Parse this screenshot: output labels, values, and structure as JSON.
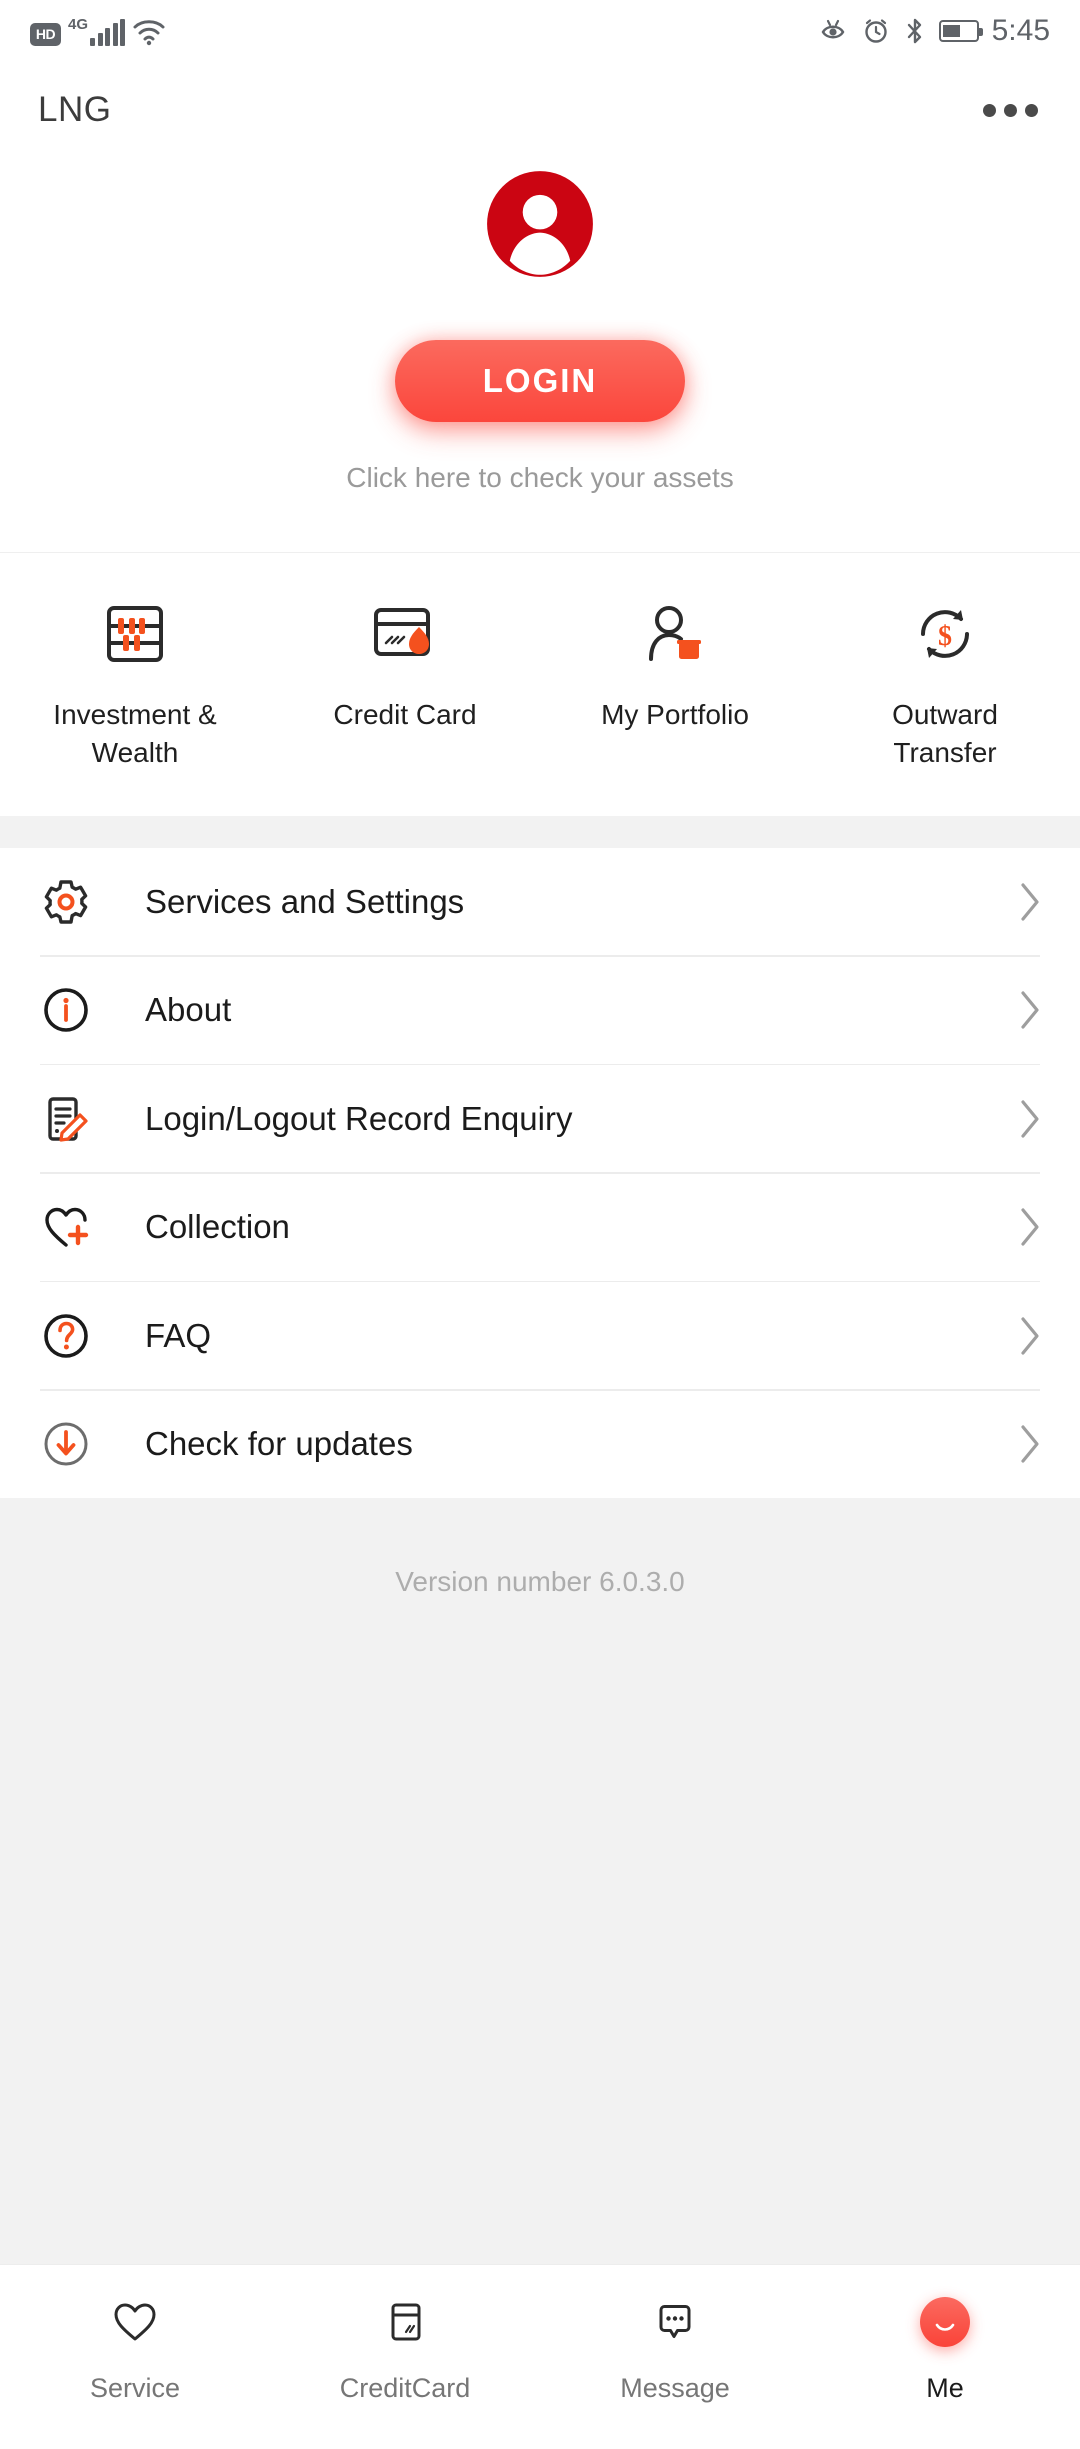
{
  "status_bar": {
    "hd_badge": "HD",
    "network_type": "4G",
    "time": "5:45",
    "icons": [
      "hd-icon",
      "signal-icon",
      "wifi-icon",
      "eye-comfort-icon",
      "alarm-icon",
      "bluetooth-icon",
      "battery-icon"
    ]
  },
  "app_bar": {
    "title": "LNG",
    "overflow_menu": "more-options"
  },
  "profile": {
    "avatar_alt": "user-avatar",
    "avatar_color": "#CB0512",
    "login_label": "LOGIN",
    "login_hint": "Click here to check your assets",
    "login_gradient_from": "#FB6A5E",
    "login_gradient_to": "#FB463C"
  },
  "quick_actions": [
    {
      "label": "Investment & Wealth",
      "icon": "abacus-icon"
    },
    {
      "label": "Credit Card",
      "icon": "credit-card-flame-icon"
    },
    {
      "label": "My Portfolio",
      "icon": "person-briefcase-icon"
    },
    {
      "label": "Outward Transfer",
      "icon": "transfer-dollar-icon"
    }
  ],
  "menu": [
    {
      "label": "Services and Settings",
      "icon": "gear-icon"
    },
    {
      "label": "About",
      "icon": "info-circle-icon"
    },
    {
      "label": "Login/Logout Record Enquiry",
      "icon": "document-pencil-icon"
    },
    {
      "label": "Collection",
      "icon": "heart-plus-icon"
    },
    {
      "label": "FAQ",
      "icon": "question-circle-icon"
    },
    {
      "label": "Check for updates",
      "icon": "download-circle-icon"
    }
  ],
  "footer": {
    "version_text": "Version number 6.0.3.0"
  },
  "tab_bar": {
    "active_index": 3,
    "items": [
      {
        "label": "Service",
        "icon": "heart-icon"
      },
      {
        "label": "CreditCard",
        "icon": "card-icon"
      },
      {
        "label": "Message",
        "icon": "chat-bubble-icon"
      },
      {
        "label": "Me",
        "icon": "me-avatar-icon"
      }
    ]
  },
  "colors": {
    "accent_orange": "#F4511E",
    "brand_red": "#CB0512",
    "button_red": "#FB4A40",
    "text_dark": "#1B1B1B",
    "text_muted": "#9A9A9A",
    "panel_gray": "#F2F2F2"
  }
}
